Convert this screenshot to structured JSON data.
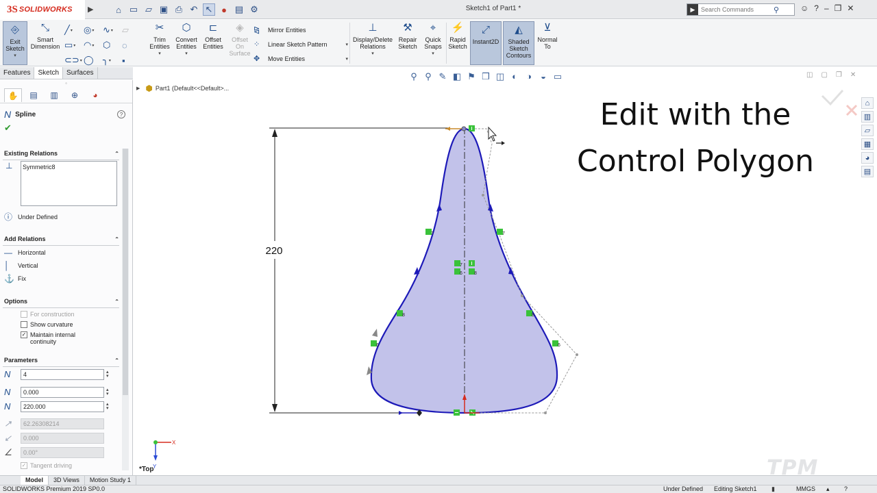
{
  "titlebar": {
    "logo_mark": "3S",
    "logo_text": "SOLIDWORKS",
    "doc_title": "Sketch1 of Part1 *",
    "search_placeholder": "Search Commands"
  },
  "ribbon": {
    "exit_sketch": [
      "Exit",
      "Sketch"
    ],
    "smart_dimension": [
      "Smart",
      "Dimension"
    ],
    "trim_entities": [
      "Trim",
      "Entities"
    ],
    "convert_entities": [
      "Convert",
      "Entities"
    ],
    "offset_entities": [
      "Offset",
      "Entities"
    ],
    "offset_on_surface": [
      "Offset",
      "On",
      "Surface"
    ],
    "mirror_entities": "Mirror Entities",
    "linear_sketch_pattern": "Linear Sketch Pattern",
    "move_entities": "Move Entities",
    "display_delete_relations": [
      "Display/Delete",
      "Relations"
    ],
    "repair_sketch": [
      "Repair",
      "Sketch"
    ],
    "quick_snaps": [
      "Quick",
      "Snaps"
    ],
    "rapid_sketch": [
      "Rapid",
      "Sketch"
    ],
    "instant2d": "Instant2D",
    "shaded_sketch_contours": [
      "Shaded",
      "Sketch",
      "Contours"
    ],
    "normal_to": [
      "Normal",
      "To"
    ]
  },
  "cmd_tabs": [
    "Features",
    "Sketch",
    "Surfaces"
  ],
  "property_manager": {
    "title": "Spline",
    "existing_relations": {
      "header": "Existing Relations",
      "items": [
        "Symmetric8"
      ],
      "status": "Under Defined"
    },
    "add_relations": {
      "header": "Add Relations",
      "items": [
        "Horizontal",
        "Vertical",
        "Fix"
      ]
    },
    "options": {
      "header": "Options",
      "for_construction": "For construction",
      "show_curvature": "Show curvature",
      "maintain_continuity": [
        "Maintain internal",
        "continuity"
      ],
      "maintain_continuity_checked": true
    },
    "parameters": {
      "header": "Parameters",
      "point_number": "4",
      "x_coordinate": "0.000",
      "y_coordinate": "220.000",
      "tangent_weight": "62.26308214",
      "tangent_weight_2": "0.000",
      "tangent_angle": "0.00°",
      "tangent_driving": "Tangent driving"
    }
  },
  "viewport": {
    "tree_root": "Part1  (Default<<Default>...",
    "caption_line1": "Edit with the",
    "caption_line2": "Control Polygon",
    "dimension_value": "220",
    "view_label": "*Top",
    "axis_x": "X",
    "axis_y": "Y",
    "watermark": "TPM"
  },
  "bottom_tabs": [
    "Model",
    "3D Views",
    "Motion Study 1"
  ],
  "status_bar": {
    "product": "SOLIDWORKS Premium 2019 SP0.0",
    "definition": "Under Defined",
    "editing": "Editing Sketch1",
    "units": "MMGS"
  },
  "colors": {
    "spline": "#1d1ab8",
    "fill": "#c2c2ea",
    "relation": "#3ac23a",
    "accent": "#d52b1e"
  }
}
